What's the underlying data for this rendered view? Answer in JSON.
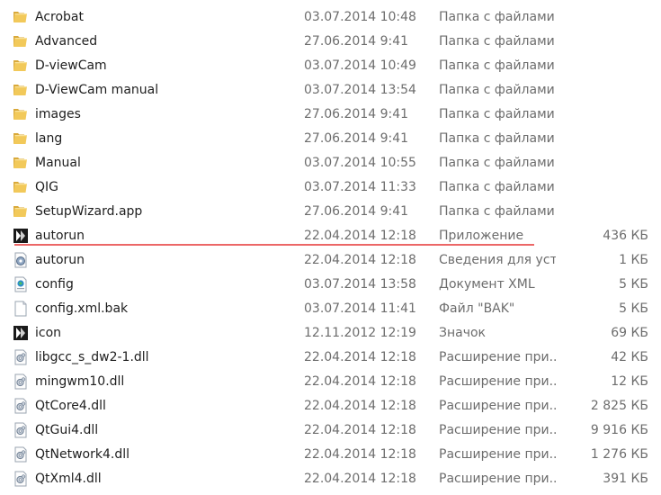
{
  "files": [
    {
      "name": "Acrobat",
      "date": "03.07.2014 10:48",
      "type": "Папка с файлами",
      "size": "",
      "icon": "folder-icon"
    },
    {
      "name": "Advanced",
      "date": "27.06.2014 9:41",
      "type": "Папка с файлами",
      "size": "",
      "icon": "folder-icon"
    },
    {
      "name": "D-viewCam",
      "date": "03.07.2014 10:49",
      "type": "Папка с файлами",
      "size": "",
      "icon": "folder-icon"
    },
    {
      "name": "D-ViewCam manual",
      "date": "03.07.2014 13:54",
      "type": "Папка с файлами",
      "size": "",
      "icon": "folder-icon"
    },
    {
      "name": "images",
      "date": "27.06.2014 9:41",
      "type": "Папка с файлами",
      "size": "",
      "icon": "folder-icon"
    },
    {
      "name": "lang",
      "date": "27.06.2014 9:41",
      "type": "Папка с файлами",
      "size": "",
      "icon": "folder-icon"
    },
    {
      "name": "Manual",
      "date": "03.07.2014 10:55",
      "type": "Папка с файлами",
      "size": "",
      "icon": "folder-icon"
    },
    {
      "name": "QIG",
      "date": "03.07.2014 11:33",
      "type": "Папка с файлами",
      "size": "",
      "icon": "folder-icon"
    },
    {
      "name": "SetupWizard.app",
      "date": "27.06.2014 9:41",
      "type": "Папка с файлами",
      "size": "",
      "icon": "folder-icon"
    },
    {
      "name": "autorun",
      "date": "22.04.2014 12:18",
      "type": "Приложение",
      "size": "436 КБ",
      "icon": "dlink-app-icon"
    },
    {
      "name": "autorun",
      "date": "22.04.2014 12:18",
      "type": "Сведения для уст...",
      "size": "1 КБ",
      "icon": "setup-info-icon"
    },
    {
      "name": "config",
      "date": "03.07.2014 13:58",
      "type": "Документ XML",
      "size": "5 КБ",
      "icon": "xml-document-icon"
    },
    {
      "name": "config.xml.bak",
      "date": "03.07.2014 11:41",
      "type": "Файл \"BAK\"",
      "size": "5 КБ",
      "icon": "blank-file-icon"
    },
    {
      "name": "icon",
      "date": "12.11.2012 12:19",
      "type": "Значок",
      "size": "69 КБ",
      "icon": "dlink-app-icon"
    },
    {
      "name": "libgcc_s_dw2-1.dll",
      "date": "22.04.2014 12:18",
      "type": "Расширение при...",
      "size": "42 КБ",
      "icon": "dll-icon"
    },
    {
      "name": "mingwm10.dll",
      "date": "22.04.2014 12:18",
      "type": "Расширение при...",
      "size": "12 КБ",
      "icon": "dll-icon"
    },
    {
      "name": "QtCore4.dll",
      "date": "22.04.2014 12:18",
      "type": "Расширение при...",
      "size": "2 825 КБ",
      "icon": "dll-icon"
    },
    {
      "name": "QtGui4.dll",
      "date": "22.04.2014 12:18",
      "type": "Расширение при...",
      "size": "9 916 КБ",
      "icon": "dll-icon"
    },
    {
      "name": "QtNetwork4.dll",
      "date": "22.04.2014 12:18",
      "type": "Расширение при...",
      "size": "1 276 КБ",
      "icon": "dll-icon"
    },
    {
      "name": "QtXml4.dll",
      "date": "22.04.2014 12:18",
      "type": "Расширение при...",
      "size": "391 КБ",
      "icon": "dll-icon"
    }
  ],
  "colors": {
    "folder": "#e8b94a",
    "folder_light": "#f6d77e",
    "annotation": "#e53535",
    "secondary_text": "#6d6d6d"
  }
}
